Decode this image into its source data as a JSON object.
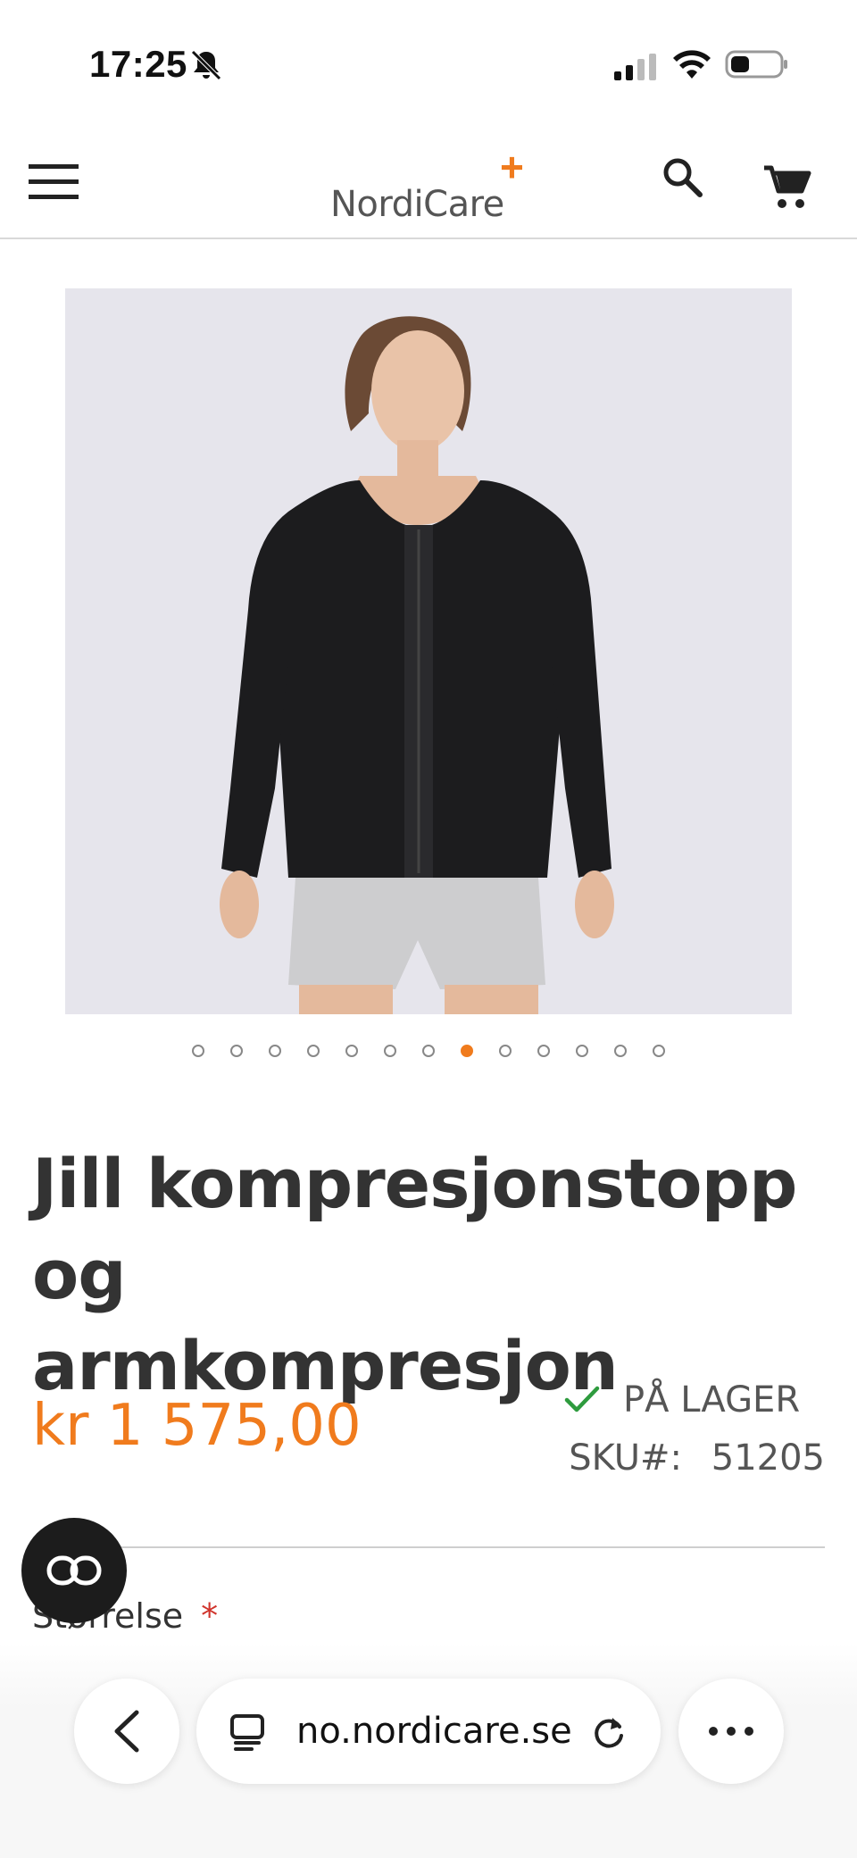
{
  "status_bar": {
    "time": "17:25",
    "icons": [
      "bell-slash-icon",
      "signal-icon",
      "wifi-icon",
      "battery-icon"
    ]
  },
  "header": {
    "logo_text": "NordiCare",
    "logo_mark": "+",
    "brand_color": "#f07b1d",
    "icons": [
      "menu-icon",
      "search-icon",
      "cart-icon"
    ]
  },
  "gallery": {
    "image_count": 13,
    "active_index": 8
  },
  "product": {
    "title_line1": "Jill kompresjonstopp og",
    "title_line2": "armkompresjon",
    "price": "kr 1 575,00",
    "stock_status": "PÅ LAGER",
    "sku_label": "SKU#:",
    "sku_value": "51205",
    "size_label": "Størrelse",
    "required_mark": "*"
  },
  "browser": {
    "url": "no.nordicare.se",
    "icons": [
      "back-chevron-icon",
      "tab-icon",
      "reload-icon",
      "more-icon"
    ]
  },
  "colors": {
    "accent": "#f07b1d",
    "stock_ok": "#2e9b3e",
    "required": "#d0342c"
  }
}
